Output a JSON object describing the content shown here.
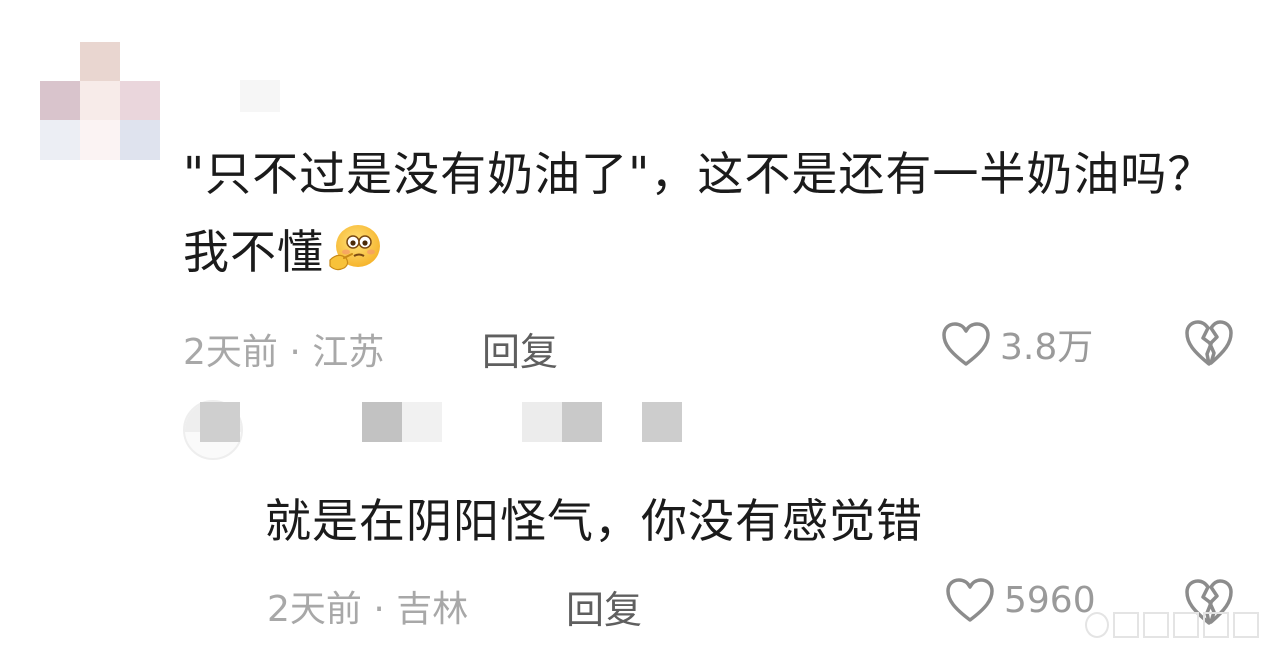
{
  "comments": [
    {
      "text": "\"只不过是没有奶油了\"，这不是还有一半奶油吗？我不懂",
      "time": "2天前",
      "separator": "·",
      "location": "江苏",
      "reply_label": "回复",
      "like_count": "3.8万",
      "emoji": "thinking-flushed-emoji"
    },
    {
      "text": "就是在阴阳怪气，你没有感觉错",
      "time": "2天前",
      "separator": "·",
      "location": "吉林",
      "reply_label": "回复",
      "like_count": "5960"
    }
  ],
  "icons": {
    "like": "heart-icon",
    "dislike": "broken-heart-icon"
  },
  "colors": {
    "text": "#1b1b1b",
    "meta": "#a8a8a8",
    "reply": "#5f5f5f",
    "icon": "#8c8c8c"
  }
}
